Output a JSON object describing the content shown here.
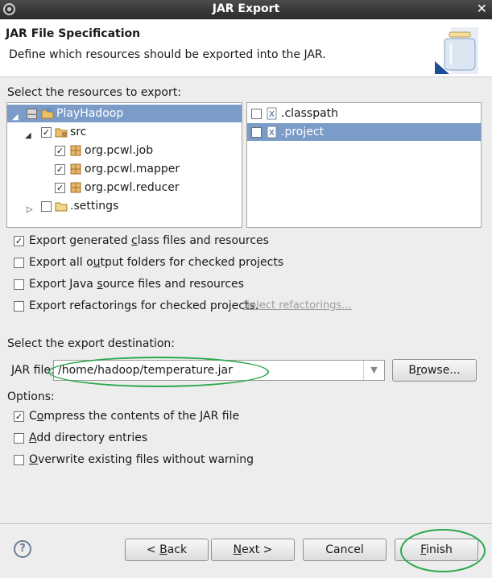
{
  "window": {
    "title": "JAR Export",
    "close_glyph": "✕"
  },
  "header": {
    "title": "JAR File Specification",
    "description": "Define which resources should be exported into the JAR.",
    "icon": "jar-icon"
  },
  "resources": {
    "label": "Select the resources to export:",
    "tree": [
      {
        "label": "PlayHadoop",
        "expanded": true,
        "checked": "partial",
        "icon": "project-folder-icon",
        "selected": true
      },
      {
        "label": "src",
        "expanded": true,
        "checked": true,
        "icon": "source-folder-icon"
      },
      {
        "label": "org.pcwl.job",
        "checked": true,
        "icon": "package-icon"
      },
      {
        "label": "org.pcwl.mapper",
        "checked": true,
        "icon": "package-icon"
      },
      {
        "label": "org.pcwl.reducer",
        "checked": true,
        "icon": "package-icon"
      },
      {
        "label": ".settings",
        "expanded": false,
        "checked": false,
        "icon": "folder-icon"
      }
    ],
    "files": [
      {
        "label": ".classpath",
        "checked": false,
        "icon": "xml-file-icon"
      },
      {
        "label": ".project",
        "checked": false,
        "icon": "xml-file-icon",
        "selected": true
      }
    ]
  },
  "export_options": [
    {
      "pre": "Export generated ",
      "mnemonic": "c",
      "post": "lass files and resources",
      "checked": true
    },
    {
      "pre": "Export all o",
      "mnemonic": "u",
      "post": "tput folders for checked projects",
      "checked": false
    },
    {
      "pre": "Export Java ",
      "mnemonic": "s",
      "post": "ource files and resources",
      "checked": false
    },
    {
      "pre": "Export refactorings for checked projects.",
      "mnemonic": "",
      "post": "",
      "checked": false
    }
  ],
  "refactorings_link": "Select refactorings...",
  "destination": {
    "label": "Select the export destination:",
    "jar_label": "JAR file:",
    "jar_value": "/home/hadoop/temperature.jar",
    "browse_pre": "B",
    "browse_mnemonic": "r",
    "browse_post": "owse..."
  },
  "options": {
    "label": "Options:",
    "items": [
      {
        "pre": "C",
        "mnemonic": "o",
        "post": "mpress the contents of the JAR file",
        "checked": true
      },
      {
        "pre": "",
        "mnemonic": "A",
        "post": "dd directory entries",
        "checked": false
      },
      {
        "pre": "",
        "mnemonic": "O",
        "post": "verwrite existing files without warning",
        "checked": false
      }
    ]
  },
  "buttons": {
    "help": "?",
    "back_pre": "< ",
    "back_mnemonic": "B",
    "back_post": "ack",
    "next_mnemonic": "N",
    "next_post": "ext >",
    "cancel": "Cancel",
    "finish_mnemonic": "F",
    "finish_post": "inish"
  },
  "colors": {
    "selection": "#7b9cc8",
    "annotation": "#2aa84a"
  }
}
